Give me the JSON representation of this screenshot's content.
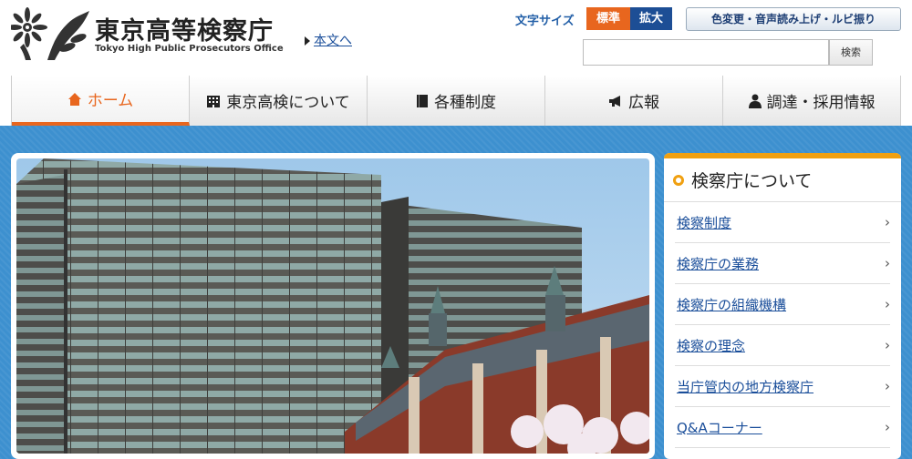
{
  "header": {
    "logo_title": "東京高等検察庁",
    "logo_subtitle": "Tokyo High Public Prosecutors Office",
    "skip_link": "本文へ",
    "font_size_label": "文字サイズ",
    "font_size_standard": "標準",
    "font_size_large": "拡大",
    "accessibility_button": "色変更・音声読み上げ・ルビ振り",
    "search_placeholder": "",
    "search_button": "検索"
  },
  "nav": {
    "items": [
      {
        "label": "ホーム",
        "icon": "home-icon",
        "active": true
      },
      {
        "label": "東京高検について",
        "icon": "building-icon",
        "active": false
      },
      {
        "label": "各種制度",
        "icon": "book-icon",
        "active": false
      },
      {
        "label": "広報",
        "icon": "megaphone-icon",
        "active": false
      },
      {
        "label": "調達・採用情報",
        "icon": "person-icon",
        "active": false
      }
    ]
  },
  "sidebar": {
    "title": "検察庁について",
    "items": [
      {
        "label": "検察制度"
      },
      {
        "label": "検察庁の業務"
      },
      {
        "label": "検察庁の組織機構"
      },
      {
        "label": "検察の理念"
      },
      {
        "label": "当庁管内の地方検察庁"
      },
      {
        "label": "Q&Aコーナー"
      }
    ]
  },
  "colors": {
    "accent_orange": "#e8661e",
    "navy": "#1d4e95",
    "link_blue": "#1a4e9a",
    "main_background": "#3d90cf",
    "sidebar_accent": "#f0a011"
  }
}
